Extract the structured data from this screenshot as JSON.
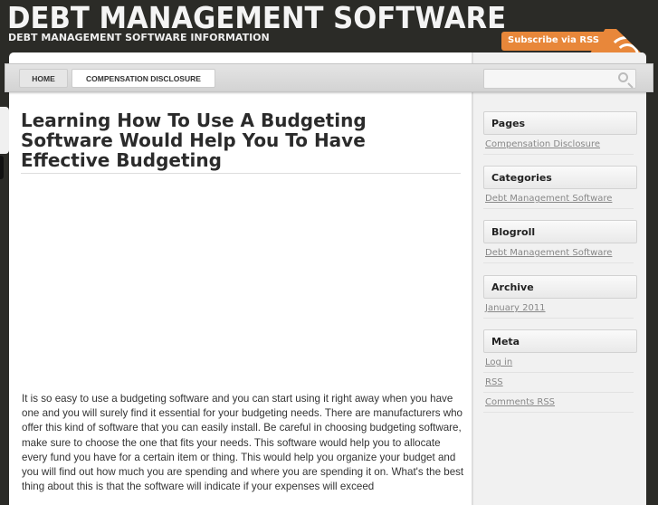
{
  "header": {
    "site_title": "DEBT MANAGEMENT SOFTWARE",
    "tagline": "DEBT MANAGEMENT SOFTWARE INFORMATION",
    "subscribe_label": "Subscribe via RSS"
  },
  "nav": {
    "items": [
      {
        "label": "HOME"
      },
      {
        "label": "COMPENSATION DISCLOSURE"
      }
    ],
    "search_placeholder": ""
  },
  "post": {
    "title": "Learning How To Use A Budgeting Software Would Help You To Have Effective Budgeting",
    "body": "It is so easy to use a budgeting software and you can start using it right away when you have one and you will surely find it essential for your budgeting needs. There are manufacturers who offer this kind of software that you can easily install. Be careful in choosing budgeting software, make sure to choose the one that fits your needs. This software would help you to allocate every fund you have for a certain item or thing. This would help you organize your budget and you will find out how much you are spending and where you are spending it on. What's the best thing about this is that the software will indicate if your expenses will exceed"
  },
  "sidebar": {
    "pages": {
      "title": "Pages",
      "links": [
        "Compensation Disclosure"
      ]
    },
    "categories": {
      "title": "Categories",
      "links": [
        "Debt Management Software"
      ]
    },
    "blogroll": {
      "title": "Blogroll",
      "links": [
        "Debt Management Software"
      ]
    },
    "archive": {
      "title": "Archive",
      "links": [
        "January 2011"
      ]
    },
    "meta": {
      "title": "Meta",
      "links": [
        "Log in",
        "RSS",
        "Comments RSS"
      ]
    }
  },
  "colors": {
    "background": "#2b2b27",
    "accent": "#e8873a"
  }
}
